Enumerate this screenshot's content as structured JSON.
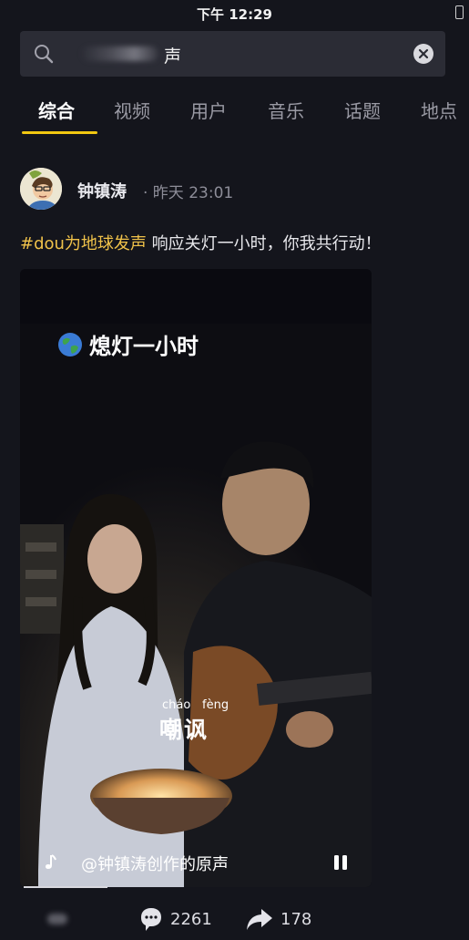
{
  "status_bar": {
    "time": "下午 12:29"
  },
  "search": {
    "query": "声"
  },
  "tabs": [
    {
      "label": "综合",
      "active": true
    },
    {
      "label": "视频"
    },
    {
      "label": "用户"
    },
    {
      "label": "音乐"
    },
    {
      "label": "话题"
    },
    {
      "label": "地点"
    }
  ],
  "post": {
    "author": "钟镇涛",
    "time": "· 昨天 23:01",
    "hashtag": "#dou为地球发声",
    "caption": " 响应关灯一小时，你我共行动！",
    "video": {
      "title": "熄灯一小时",
      "subtitle_pinyin_1": "cháo",
      "subtitle_pinyin_2": "fèng",
      "subtitle_text": "嘲讽",
      "music": "@钟镇涛创作的原声"
    },
    "stats": {
      "comments": "2261",
      "shares": "178"
    }
  },
  "colors": {
    "accent": "#f2c811",
    "hashtag": "#f0c24a",
    "background": "#14151c"
  },
  "icons": [
    "search-icon",
    "clear-icon",
    "globe-icon",
    "music-note-icon",
    "pause-icon",
    "comment-icon",
    "share-icon"
  ]
}
